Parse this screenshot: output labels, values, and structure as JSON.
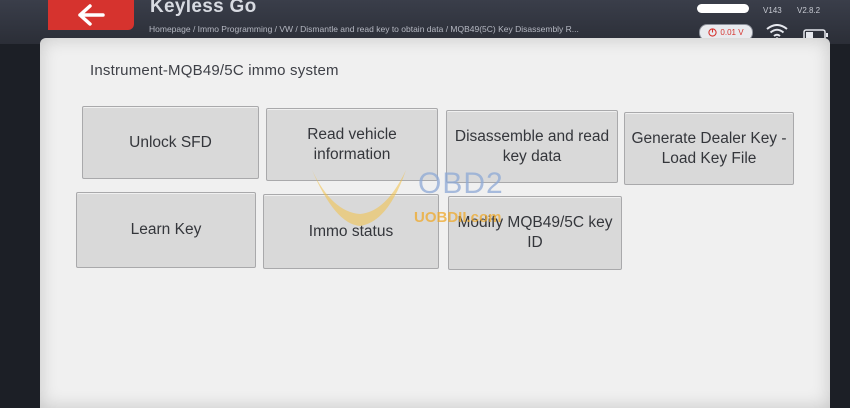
{
  "header": {
    "app_title": "Keyless Go",
    "breadcrumb": "Homepage / Immo Programming / VW / Dismantle and read key to obtain data / MQB49(5C) Key Disassembly R...",
    "version_a": "V143",
    "version_b": "V2.8.2",
    "voltage": "0.01 V"
  },
  "main": {
    "section_title": "Instrument-MQB49/5C immo system",
    "buttons": [
      {
        "label": "Unlock SFD"
      },
      {
        "label": "Read vehicle information"
      },
      {
        "label": "Disassemble and read key data"
      },
      {
        "label": "Generate Dealer Key - Load Key File"
      },
      {
        "label": "Learn Key"
      },
      {
        "label": "Immo status"
      },
      {
        "label": "Modify MQB49/5C key ID"
      }
    ]
  },
  "watermark": {
    "brand": "OBD2",
    "site": "UOBDII.com"
  },
  "colors": {
    "accent": "#d6332e",
    "tile": "#d9d9d9",
    "panel": "#f0f0f0",
    "header": "#2b2e37"
  },
  "icons": [
    "back-arrow-icon",
    "power-icon",
    "wifi-icon",
    "battery-icon"
  ]
}
